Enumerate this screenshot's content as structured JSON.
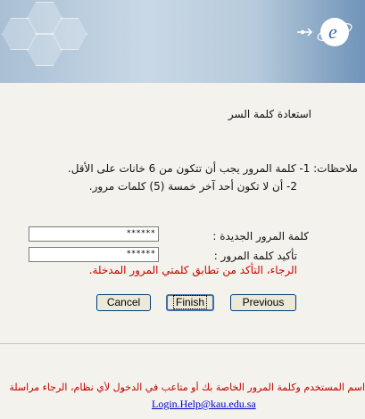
{
  "banner": {
    "logo_icon": "e-logo-icon",
    "logo_text": "e"
  },
  "page": {
    "title": "استعادة كلمة السر"
  },
  "notes": {
    "line1": "ملاحظات: 1- كلمة المرور يجب أن تتكون من 6 خانات على الأقل.",
    "line2": "2- أن لا تكون أحد آخر خمسة (5) كلمات مرور."
  },
  "form": {
    "new_password_label": "كلمة المرور الجديدة :",
    "new_password_value": "******",
    "confirm_password_label": "تأكيد كلمة المرور :",
    "confirm_password_value": "******",
    "mismatch_warning": "الرجاء، التأكد من تطابق كلمتي المرور المدخلة."
  },
  "buttons": {
    "cancel": "Cancel",
    "finish": "Finish",
    "previous": "Previous"
  },
  "footer": {
    "message": "اسم المستخدم وكلمة المرور الخاصة بك أو متاعب في الدخول لأي نظام، الرجاء مراسلة",
    "email": "Login.Help@kau.edu.sa"
  },
  "colors": {
    "warning": "#cc0000",
    "link": "#0000cc",
    "background": "#f4f2ec"
  }
}
